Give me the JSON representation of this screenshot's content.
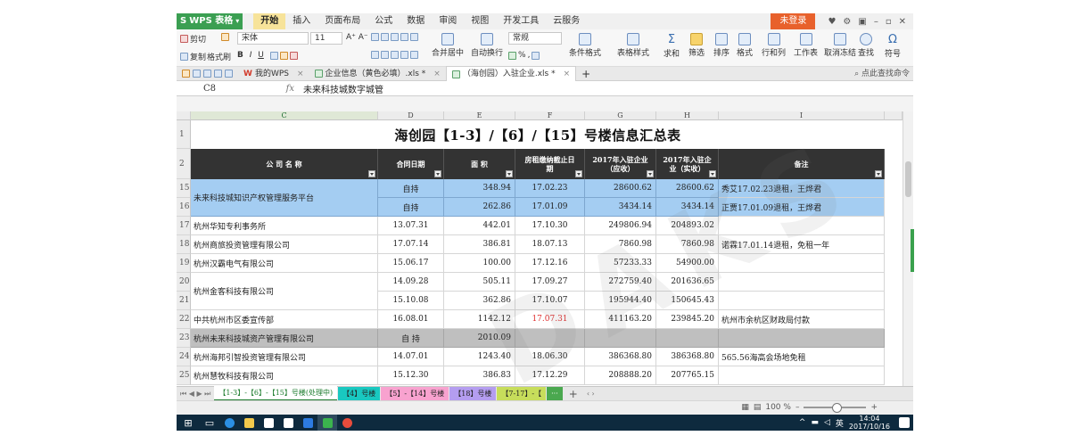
{
  "app": {
    "name": "WPS 表格",
    "login_label": "未登录",
    "tabs": [
      "开始",
      "插入",
      "页面布局",
      "公式",
      "数据",
      "审阅",
      "视图",
      "开发工具",
      "云服务"
    ]
  },
  "ribbon": {
    "cut": "剪切",
    "copy": "复制",
    "format_painter": "格式刷",
    "font": "宋体",
    "size": "11",
    "merge": "合并居中",
    "wrap": "自动换行",
    "number_format": "常规",
    "cond_format": "条件格式",
    "table_style": "表格样式",
    "sum": "求和",
    "filter": "筛选",
    "sort": "排序",
    "format": "格式",
    "rows_cols": "行和列",
    "worksheet": "工作表",
    "unfreeze": "取消冻结",
    "find": "查找",
    "symbol": "符号"
  },
  "doc_tabs": [
    {
      "label": "我的WPS"
    },
    {
      "label": "企业信息（黄色必填）.xls *"
    },
    {
      "label": "（海创园）入驻企业.xls *"
    }
  ],
  "doc_search": "点此查找命令",
  "formula": {
    "cell": "C8",
    "fx": "fx",
    "value": "未来科技城数字城管"
  },
  "columns": [
    "C",
    "D",
    "E",
    "F",
    "G",
    "H",
    "I"
  ],
  "sheet_title": "海创园【1-3】/【6】/【15】号楼信息汇总表",
  "headers": {
    "company": "公 司 名 称",
    "date": "合同日期",
    "area": "面 积",
    "deadline": "房租缴纳截止日期",
    "due": "2017年入驻企业（应收）",
    "paid": "2017年入驻企业（实收）",
    "note": "备注"
  },
  "row_labels": {
    "title": "1",
    "header": "2"
  },
  "rows": [
    {
      "num": "15",
      "company": "未来科技城知识产权管理服务平台",
      "date": "自持",
      "area": "348.94",
      "deadline": "17.02.23",
      "due": "28600.62",
      "paid": "28600.62",
      "note": "秀艾17.02.23退租，王烨君"
    },
    {
      "num": "16",
      "company": "",
      "date": "自持",
      "area": "262.86",
      "deadline": "17.01.09",
      "due": "3434.14",
      "paid": "3434.14",
      "note": "正贾17.01.09退租，王烨君"
    },
    {
      "num": "17",
      "company": "杭州华知专利事务所",
      "date": "13.07.31",
      "area": "442.01",
      "deadline": "17.10.30",
      "due": "249806.94",
      "paid": "204893.02",
      "note": ""
    },
    {
      "num": "18",
      "company": "杭州商旅投资管理有限公司",
      "date": "17.07.14",
      "area": "386.81",
      "deadline": "18.07.13",
      "due": "7860.98",
      "paid": "7860.98",
      "note": "诺霖17.01.14退租，免租一年"
    },
    {
      "num": "19",
      "company": "杭州汉霸电气有限公司",
      "date": "15.06.17",
      "area": "100.00",
      "deadline": "17.12.16",
      "due": "57233.33",
      "paid": "54900.00",
      "note": ""
    },
    {
      "num": "20",
      "company": "杭州金客科技有限公司",
      "date": "14.09.28",
      "area": "505.11",
      "deadline": "17.09.27",
      "due": "272759.40",
      "paid": "201636.65",
      "note": ""
    },
    {
      "num": "21",
      "company": "",
      "date": "15.10.08",
      "area": "362.86",
      "deadline": "17.10.07",
      "due": "195944.40",
      "paid": "150645.43",
      "note": ""
    },
    {
      "num": "22",
      "company": "中共杭州市区委宣传部",
      "date": "16.08.01",
      "area": "1142.12",
      "deadline": "17.07.31",
      "due": "411163.20",
      "paid": "239845.20",
      "note": "杭州市余杭区财政局付款"
    },
    {
      "num": "23",
      "company": "杭州未来科技城资产管理有限公司",
      "date": "自 持",
      "area": "2010.09",
      "deadline": "",
      "due": "",
      "paid": "",
      "note": ""
    },
    {
      "num": "24",
      "company": "杭州海邦引智投资管理有限公司",
      "date": "14.07.01",
      "area": "1243.40",
      "deadline": "18.06.30",
      "due": "386368.80",
      "paid": "386368.80",
      "note": "565.56海高会场地免租"
    },
    {
      "num": "25",
      "company": "杭州慧牧科技有限公司",
      "date": "15.12.30",
      "area": "386.83",
      "deadline": "17.12.29",
      "due": "208888.20",
      "paid": "207765.15",
      "note": ""
    }
  ],
  "sheet_tabs": [
    "【1-3】-【6】-【15】号楼(处理中)",
    "【4】号楼",
    "【5】-【14】号楼",
    "【18】号楼",
    "【7-17】-【",
    "···"
  ],
  "status": {
    "zoom": "100 %"
  },
  "taskbar": {
    "time": "14:04",
    "date": "2017/10/16",
    "lang": "英"
  },
  "colors": {
    "accent_green": "#3b9f52",
    "login": "#e8612c",
    "row_blue": "#a4cdf2",
    "row_gray": "#bfbfbf",
    "header_dark": "#333333",
    "red_text": "#e03030"
  }
}
